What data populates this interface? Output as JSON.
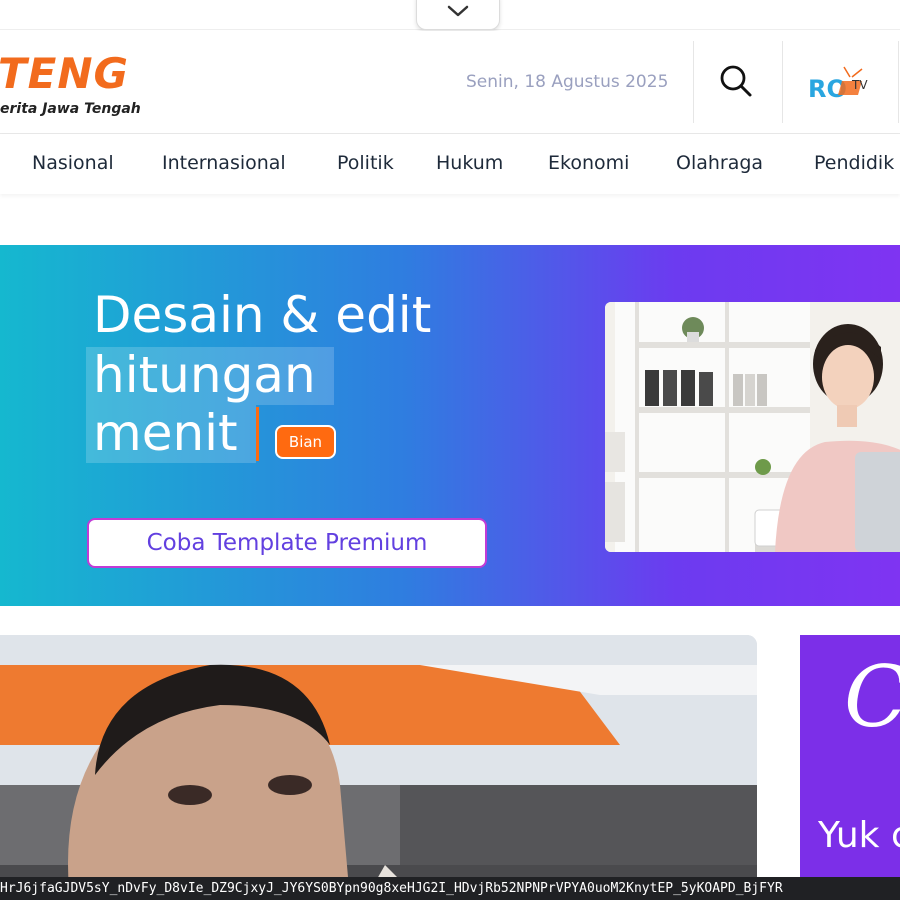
{
  "header": {
    "logo_word": "TENG",
    "logo_tagline": "erita Jawa Tengah",
    "date": "Senin, 18 Agustus 2025",
    "rotv_label": "TV",
    "rotv_letters": "RO"
  },
  "nav": {
    "items": [
      "Nasional",
      "Internasional",
      "Politik",
      "Hukum",
      "Ekonomi",
      "Olahraga",
      "Pendidik"
    ]
  },
  "banner": {
    "line1": "Desain & edit",
    "line2": "hitungan",
    "line3": "menit",
    "tag": "Bian",
    "cta": "Coba Template Premium"
  },
  "side_ad": {
    "logo_letter": "C",
    "text": "Yuk c"
  },
  "status_bar": {
    "url": "HrJ6jfaGJDV5sY_nDvFy_D8vIe_DZ9CjxyJ_JY6YS0BYpn90g8xeHJG2I_HDvjRb52NPNPrVPYA0uoM2KnytEP_5yKOAPD_BjFYR"
  },
  "colors": {
    "brand_orange": "#f26b1d",
    "nav_text": "#1e2a3a",
    "date_text": "#9aa0bf",
    "banner_start": "#15b8cf",
    "banner_end": "#7f34f2",
    "cta_text": "#6240e0",
    "side_ad_bg": "#7c2fe8"
  }
}
